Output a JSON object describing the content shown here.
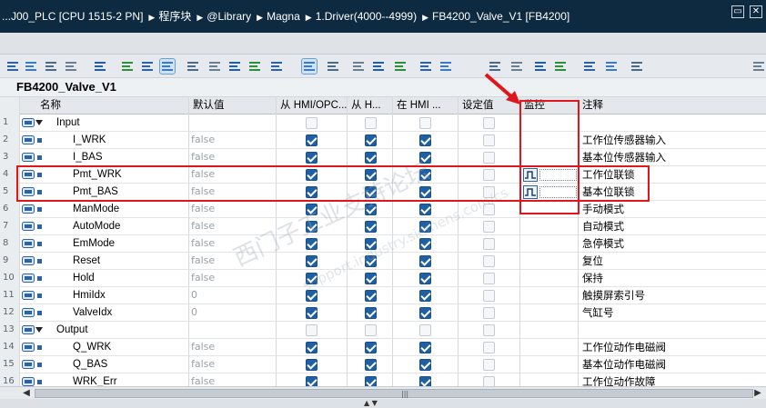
{
  "title_bar": {
    "crumbs": [
      "...J00_PLC [CPU 1515-2 PN]",
      "程序块",
      "@Library",
      "Magna",
      "1.Driver(4000--4999)",
      "FB4200_Valve_V1 [FB4200]"
    ],
    "separator": "▶",
    "min_icon": "minimize-icon",
    "close_icon": "close-icon"
  },
  "block_name": "FB4200_Valve_V1",
  "columns": {
    "name": "名称",
    "default": "默认值",
    "hmi1": "从 HMI/OPC...",
    "hmi2": "从 H...",
    "hmi3": "在 HMI ...",
    "setpoint": "设定值",
    "monitor": "监控",
    "comment": "注释"
  },
  "rows": [
    {
      "num": "1",
      "type": "section",
      "name": "Input",
      "default": "",
      "hmi": [
        false,
        false,
        false
      ],
      "set": false,
      "monitor": false,
      "comment": ""
    },
    {
      "num": "2",
      "type": "var",
      "name": "I_WRK",
      "default": "false",
      "hmi": [
        true,
        true,
        true
      ],
      "set": false,
      "monitor": false,
      "comment": "工作位传感器输入"
    },
    {
      "num": "3",
      "type": "var",
      "name": "I_BAS",
      "default": "false",
      "hmi": [
        true,
        true,
        true
      ],
      "set": false,
      "monitor": false,
      "comment": "基本位传感器输入"
    },
    {
      "num": "4",
      "type": "var",
      "name": "Pmt_WRK",
      "default": "false",
      "hmi": [
        true,
        true,
        true
      ],
      "set": false,
      "monitor": true,
      "comment": "工作位联锁"
    },
    {
      "num": "5",
      "type": "var",
      "name": "Pmt_BAS",
      "default": "false",
      "hmi": [
        true,
        true,
        true
      ],
      "set": false,
      "monitor": true,
      "comment": "基本位联锁"
    },
    {
      "num": "6",
      "type": "var",
      "name": "ManMode",
      "default": "false",
      "hmi": [
        true,
        true,
        true
      ],
      "set": false,
      "monitor": false,
      "comment": "手动模式"
    },
    {
      "num": "7",
      "type": "var",
      "name": "AutoMode",
      "default": "false",
      "hmi": [
        true,
        true,
        true
      ],
      "set": false,
      "monitor": false,
      "comment": "自动模式"
    },
    {
      "num": "8",
      "type": "var",
      "name": "EmMode",
      "default": "false",
      "hmi": [
        true,
        true,
        true
      ],
      "set": false,
      "monitor": false,
      "comment": "急停模式"
    },
    {
      "num": "9",
      "type": "var",
      "name": "Reset",
      "default": "false",
      "hmi": [
        true,
        true,
        true
      ],
      "set": false,
      "monitor": false,
      "comment": "复位"
    },
    {
      "num": "10",
      "type": "var",
      "name": "Hold",
      "default": "false",
      "hmi": [
        true,
        true,
        true
      ],
      "set": false,
      "monitor": false,
      "comment": "保持"
    },
    {
      "num": "11",
      "type": "var",
      "name": "HmiIdx",
      "default": "0",
      "hmi": [
        true,
        true,
        true
      ],
      "set": false,
      "monitor": false,
      "comment": "触摸屏索引号"
    },
    {
      "num": "12",
      "type": "var",
      "name": "ValveIdx",
      "default": "0",
      "hmi": [
        true,
        true,
        true
      ],
      "set": false,
      "monitor": false,
      "comment": "气缸号"
    },
    {
      "num": "13",
      "type": "section",
      "name": "Output",
      "default": "",
      "hmi": [
        false,
        false,
        false
      ],
      "set": false,
      "monitor": false,
      "comment": ""
    },
    {
      "num": "14",
      "type": "var",
      "name": "Q_WRK",
      "default": "false",
      "hmi": [
        true,
        true,
        true
      ],
      "set": false,
      "monitor": false,
      "comment": "工作位动作电磁阀"
    },
    {
      "num": "15",
      "type": "var",
      "name": "Q_BAS",
      "default": "false",
      "hmi": [
        true,
        true,
        true
      ],
      "set": false,
      "monitor": false,
      "comment": "基本位动作电磁阀"
    },
    {
      "num": "16",
      "type": "var",
      "name": "WRK_Err",
      "default": "false",
      "hmi": [
        true,
        true,
        true
      ],
      "set": false,
      "monitor": false,
      "comment": "工作位动作故障"
    }
  ],
  "watermark": "西门子工业支持论坛",
  "watermark_url": "support.industry.siemens.com/cs",
  "colors": {
    "title_bg": "#0d2a40",
    "checkbox_on": "#1f5fa4",
    "annotation": "#e0161d"
  }
}
